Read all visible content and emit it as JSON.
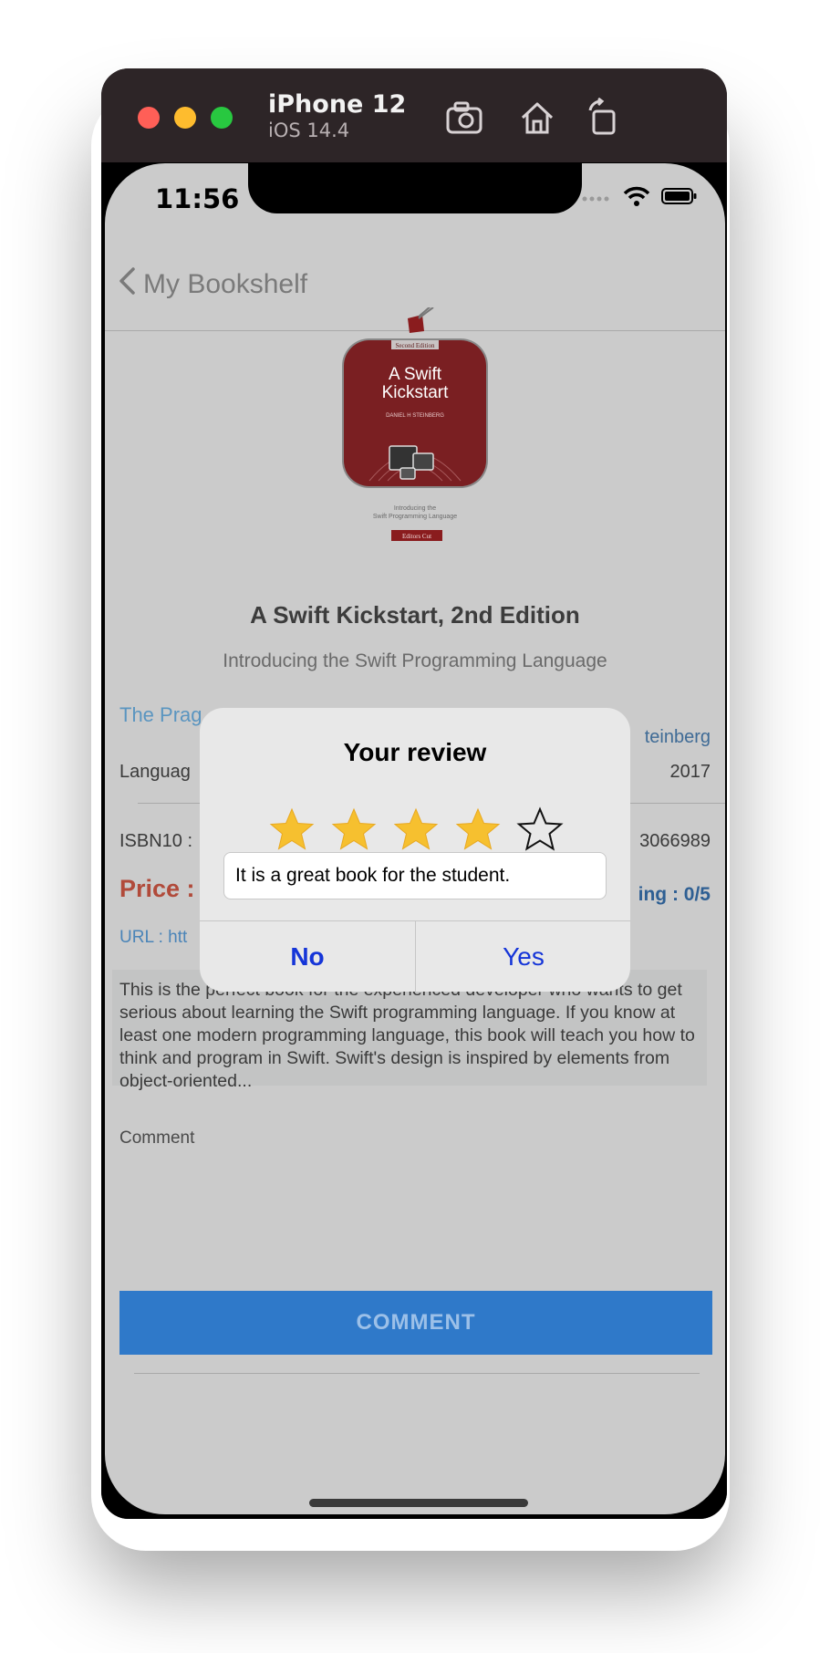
{
  "simulator": {
    "device_name": "iPhone 12",
    "os_version": "iOS 14.4",
    "toolbar_icons": [
      "camera-icon",
      "home-icon",
      "rotate-icon"
    ]
  },
  "status_bar": {
    "time": "11:56"
  },
  "nav": {
    "back_label": "My Bookshelf"
  },
  "book": {
    "cover": {
      "edition_tag": "Second Edition",
      "title_line1": "A Swift",
      "title_line2": "Kickstart",
      "author": "DANIEL H STEINBERG",
      "intro_line1": "Introducing the",
      "intro_line2": "Swift Programming Language",
      "publisher_tag": "Editors Cut",
      "color": "#7a1f22"
    },
    "title": "A Swift Kickstart, 2nd Edition",
    "subtitle": "Introducing the Swift Programming Language",
    "publisher_partial": "The Prag",
    "author_partial": "teinberg",
    "language_partial": "Languag",
    "year": "2017",
    "isbn10_label": "ISBN10 :",
    "isbn13_partial": "3066989",
    "price_label": "Price :",
    "rating_partial": "ing : 0/5",
    "url_partial": "URL : htt",
    "description": "This is the perfect book for the experienced developer who wants to get serious about learning the Swift programming language. If you know at least one modern programming language, this book will teach you how to think and program in Swift. Swift's design is inspired by elements from object-oriented...",
    "comment_label": "Comment",
    "comment_button": "COMMENT"
  },
  "dialog": {
    "title": "Your review",
    "rating": 4,
    "max_rating": 5,
    "review_text": "It is a great book for the student.",
    "no_label": "No",
    "yes_label": "Yes"
  },
  "colors": {
    "accent_button": "#2f79c9",
    "dialog_button_text": "#1535d8",
    "price": "#b14a3a",
    "star_filled": "#f6c02f"
  }
}
